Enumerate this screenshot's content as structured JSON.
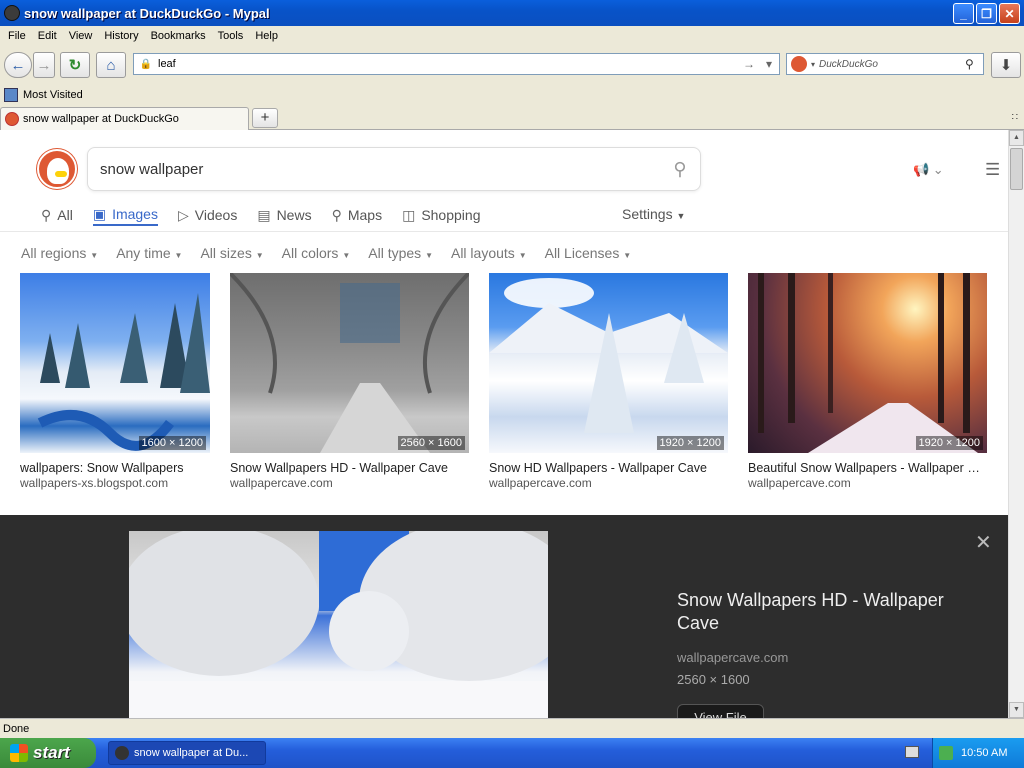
{
  "window": {
    "title": "snow wallpaper at DuckDuckGo - Mypal",
    "buttons": [
      "_",
      "❐",
      "✕"
    ]
  },
  "menu": [
    "File",
    "Edit",
    "View",
    "History",
    "Bookmarks",
    "Tools",
    "Help"
  ],
  "nav": {
    "url": "leaf",
    "search_placeholder": "DuckDuckGo"
  },
  "bookmarks": {
    "most_visited": "Most Visited"
  },
  "tabs": [
    {
      "label": "snow wallpaper at DuckDuckGo"
    }
  ],
  "page": {
    "query": "snow wallpaper",
    "vertical_tabs": [
      {
        "label": "All",
        "icon": "search-icon"
      },
      {
        "label": "Images",
        "icon": "image-icon",
        "active": true
      },
      {
        "label": "Videos",
        "icon": "play-icon"
      },
      {
        "label": "News",
        "icon": "news-icon"
      },
      {
        "label": "Maps",
        "icon": "map-pin-icon"
      },
      {
        "label": "Shopping",
        "icon": "shopping-bag-icon"
      }
    ],
    "settings": "Settings",
    "filters": [
      "All regions",
      "Any time",
      "All sizes",
      "All colors",
      "All types",
      "All layouts",
      "All Licenses"
    ],
    "results": [
      {
        "title": "wallpapers: Snow Wallpapers",
        "source": "wallpapers-xs.blogspot.com",
        "dims": "1600 × 1200"
      },
      {
        "title": "Snow Wallpapers HD - Wallpaper Cave",
        "source": "wallpapercave.com",
        "dims": "2560 × 1600"
      },
      {
        "title": "Snow HD Wallpapers - Wallpaper Cave",
        "source": "wallpapercave.com",
        "dims": "1920 × 1200"
      },
      {
        "title": "Beautiful Snow Wallpapers - Wallpaper Cave",
        "source": "wallpapercave.com",
        "dims": "1920 × 1200"
      }
    ],
    "detail": {
      "title": "Snow Wallpapers HD - Wallpaper Cave",
      "source": "wallpapercave.com",
      "dims": "2560 × 1600",
      "button": "View File"
    }
  },
  "status": "Done",
  "taskbar": {
    "start": "start",
    "task": "snow wallpaper at Du...",
    "clock": "10:50 AM"
  }
}
